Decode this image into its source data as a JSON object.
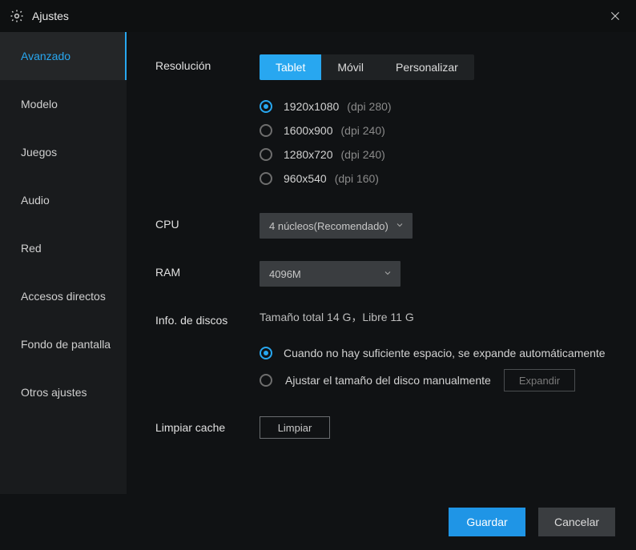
{
  "window": {
    "title": "Ajustes"
  },
  "sidebar": {
    "items": [
      {
        "label": "Avanzado"
      },
      {
        "label": "Modelo"
      },
      {
        "label": "Juegos"
      },
      {
        "label": "Audio"
      },
      {
        "label": "Red"
      },
      {
        "label": "Accesos directos"
      },
      {
        "label": "Fondo de pantalla"
      },
      {
        "label": "Otros ajustes"
      }
    ]
  },
  "sections": {
    "resolution": {
      "label": "Resolución",
      "tabs": [
        {
          "label": "Tablet"
        },
        {
          "label": "Móvil"
        },
        {
          "label": "Personalizar"
        }
      ],
      "options": [
        {
          "res": "1920x1080",
          "dpi": "(dpi 280)"
        },
        {
          "res": "1600x900",
          "dpi": "(dpi 240)"
        },
        {
          "res": "1280x720",
          "dpi": "(dpi 240)"
        },
        {
          "res": "960x540",
          "dpi": "(dpi 160)"
        }
      ]
    },
    "cpu": {
      "label": "CPU",
      "value": "4 núcleos(Recomendado)"
    },
    "ram": {
      "label": "RAM",
      "value": "4096M"
    },
    "disk": {
      "label": "Info. de discos",
      "info": "Tamaño total 14 G，Libre 11 G",
      "opt_auto": "Cuando no hay suficiente espacio, se expande automáticamente",
      "opt_manual": "Ajustar el tamaño del disco manualmente",
      "expand_btn": "Expandir"
    },
    "cache": {
      "label": "Limpiar cache",
      "btn": "Limpiar"
    }
  },
  "footer": {
    "save": "Guardar",
    "cancel": "Cancelar"
  }
}
